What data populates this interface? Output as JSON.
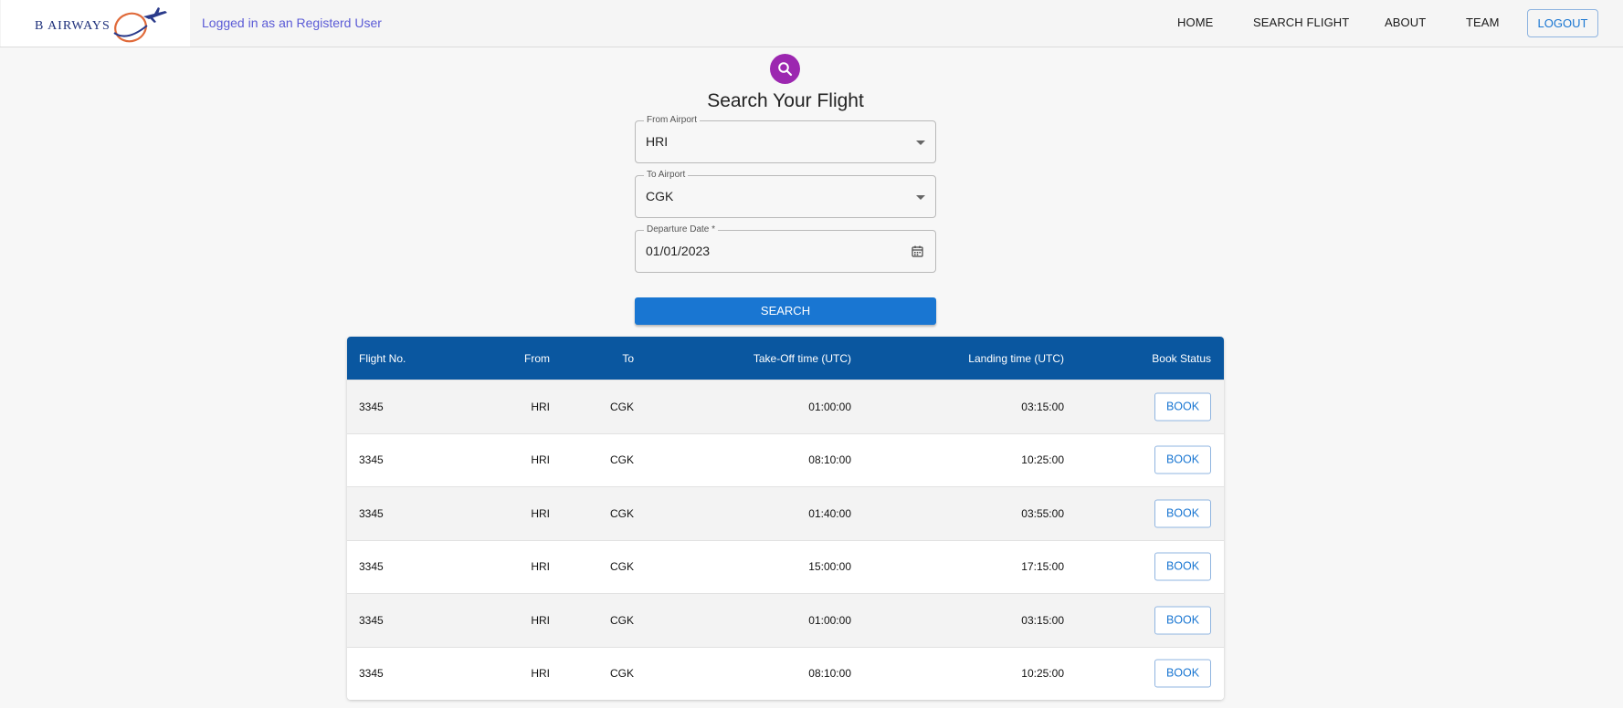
{
  "header": {
    "logo_text": "B AIRWAYS",
    "login_status": "Logged in as an Registerd User",
    "nav": {
      "home": "HOME",
      "search_flight": "SEARCH FLIGHT",
      "about": "ABOUT",
      "team": "TEAM",
      "logout": "LOGOUT"
    }
  },
  "search_form": {
    "icon": "search-icon",
    "title": "Search Your Flight",
    "from_airport": {
      "label": "From Airport",
      "value": "HRI"
    },
    "to_airport": {
      "label": "To Airport",
      "value": "CGK"
    },
    "departure_date": {
      "label": "Departure Date *",
      "value": "01/01/2023"
    },
    "search_button": "SEARCH"
  },
  "results": {
    "headers": {
      "flight_no": "Flight No.",
      "from": "From",
      "to": "To",
      "takeoff": "Take-Off time (UTC)",
      "landing": "Landing time (UTC)",
      "status": "Book Status"
    },
    "rows": [
      {
        "flight_no": "3345",
        "from": "HRI",
        "to": "CGK",
        "takeoff": "01:00:00",
        "landing": "03:15:00",
        "action": "BOOK"
      },
      {
        "flight_no": "3345",
        "from": "HRI",
        "to": "CGK",
        "takeoff": "08:10:00",
        "landing": "10:25:00",
        "action": "BOOK"
      },
      {
        "flight_no": "3345",
        "from": "HRI",
        "to": "CGK",
        "takeoff": "01:40:00",
        "landing": "03:55:00",
        "action": "BOOK"
      },
      {
        "flight_no": "3345",
        "from": "HRI",
        "to": "CGK",
        "takeoff": "15:00:00",
        "landing": "17:15:00",
        "action": "BOOK"
      },
      {
        "flight_no": "3345",
        "from": "HRI",
        "to": "CGK",
        "takeoff": "01:00:00",
        "landing": "03:15:00",
        "action": "BOOK"
      },
      {
        "flight_no": "3345",
        "from": "HRI",
        "to": "CGK",
        "takeoff": "08:10:00",
        "landing": "10:25:00",
        "action": "BOOK"
      }
    ]
  },
  "colors": {
    "primary": "#1976d2",
    "table_header": "#0a57a0",
    "avatar": "#9c27b0",
    "login_text": "#5b5bd6"
  }
}
